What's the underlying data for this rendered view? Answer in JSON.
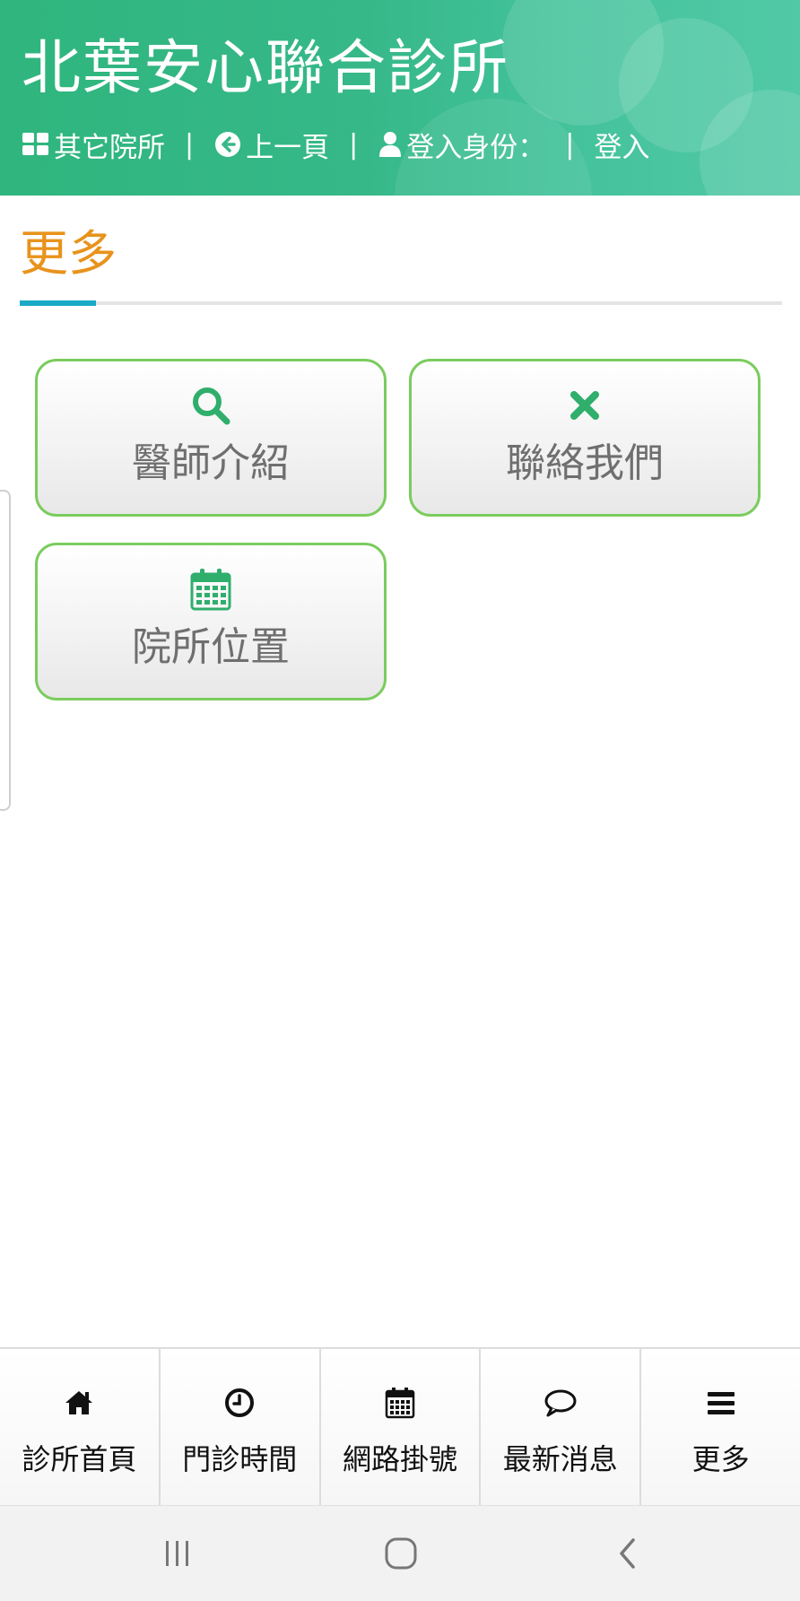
{
  "header": {
    "title": "北葉安心聯合診所",
    "nav": {
      "other_clinics": "其它院所",
      "sep": "|",
      "back": "上一頁",
      "login_identity": "登入身份：",
      "login": "登入"
    },
    "colors": {
      "start": "#2fb57d",
      "end": "#52c9a6"
    }
  },
  "section": {
    "title": "更多",
    "title_color": "#e8931c",
    "accent_color": "#1aa9c6"
  },
  "cards": [
    {
      "label": "醫師介紹",
      "icon": "search-icon"
    },
    {
      "label": "聯絡我們",
      "icon": "close-icon"
    },
    {
      "label": "院所位置",
      "icon": "calendar-icon"
    }
  ],
  "card_style": {
    "border_color": "#7bcc5e",
    "icon_color": "#2fae6c"
  },
  "tabbar": {
    "items": [
      {
        "label": "診所首頁",
        "icon": "home-icon"
      },
      {
        "label": "門診時間",
        "icon": "clock-icon"
      },
      {
        "label": "網路掛號",
        "icon": "calendar-icon"
      },
      {
        "label": "最新消息",
        "icon": "chat-bubble-icon"
      },
      {
        "label": "更多",
        "icon": "menu-icon"
      }
    ]
  },
  "system_nav": {
    "buttons": [
      "recent-apps-icon",
      "home-circle-icon",
      "back-chevron-icon"
    ]
  }
}
